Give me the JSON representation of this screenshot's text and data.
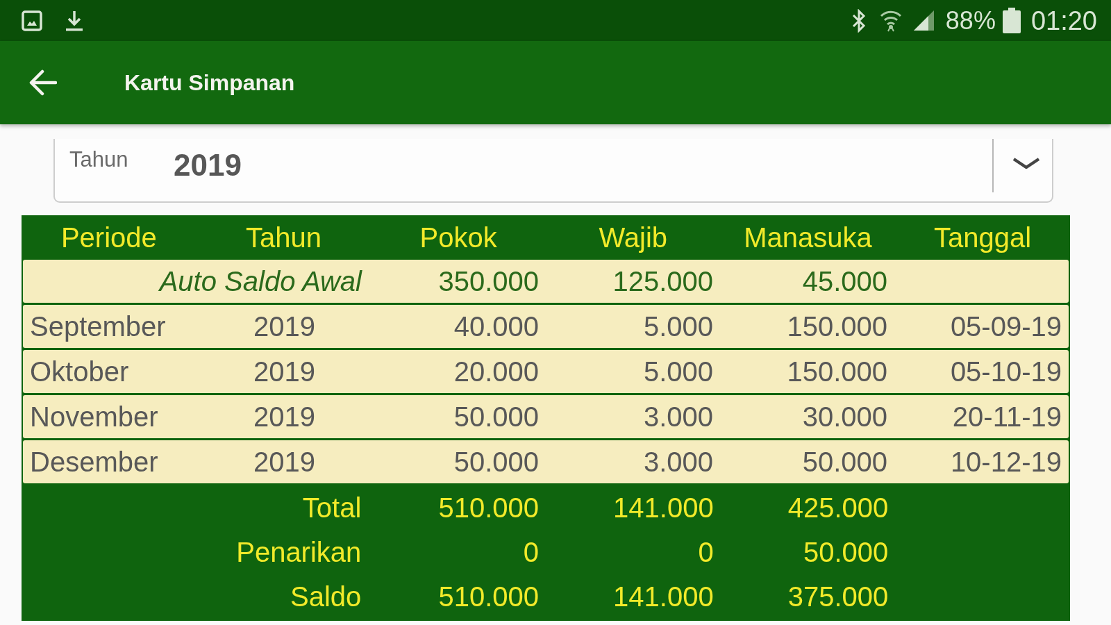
{
  "status_bar": {
    "battery": "88%",
    "time": "01:20"
  },
  "app_bar": {
    "title": "Kartu Simpanan"
  },
  "year_picker": {
    "label": "Tahun",
    "value": "2019"
  },
  "table": {
    "columns": [
      "Periode",
      "Tahun",
      "Pokok",
      "Wajib",
      "Manasuka",
      "Tanggal"
    ],
    "rows": [
      {
        "kind": "opening",
        "label": "Auto Saldo Awal",
        "values": [
          "350.000",
          "125.000",
          "45.000"
        ]
      },
      {
        "kind": "entry",
        "cells": [
          "September",
          "2019",
          "40.000",
          "5.000",
          "150.000",
          "05-09-19"
        ]
      },
      {
        "kind": "entry",
        "cells": [
          "Oktober",
          "2019",
          "20.000",
          "5.000",
          "150.000",
          "05-10-19"
        ]
      },
      {
        "kind": "entry",
        "cells": [
          "November",
          "2019",
          "50.000",
          "3.000",
          "30.000",
          "20-11-19"
        ]
      },
      {
        "kind": "entry",
        "cells": [
          "Desember",
          "2019",
          "50.000",
          "3.000",
          "50.000",
          "10-12-19"
        ]
      }
    ],
    "summary": [
      {
        "label": "Total",
        "values": [
          "510.000",
          "141.000",
          "425.000"
        ]
      },
      {
        "label": "Penarikan",
        "values": [
          "0",
          "0",
          "50.000"
        ]
      },
      {
        "label": "Saldo",
        "values": [
          "510.000",
          "141.000",
          "375.000"
        ]
      }
    ]
  }
}
